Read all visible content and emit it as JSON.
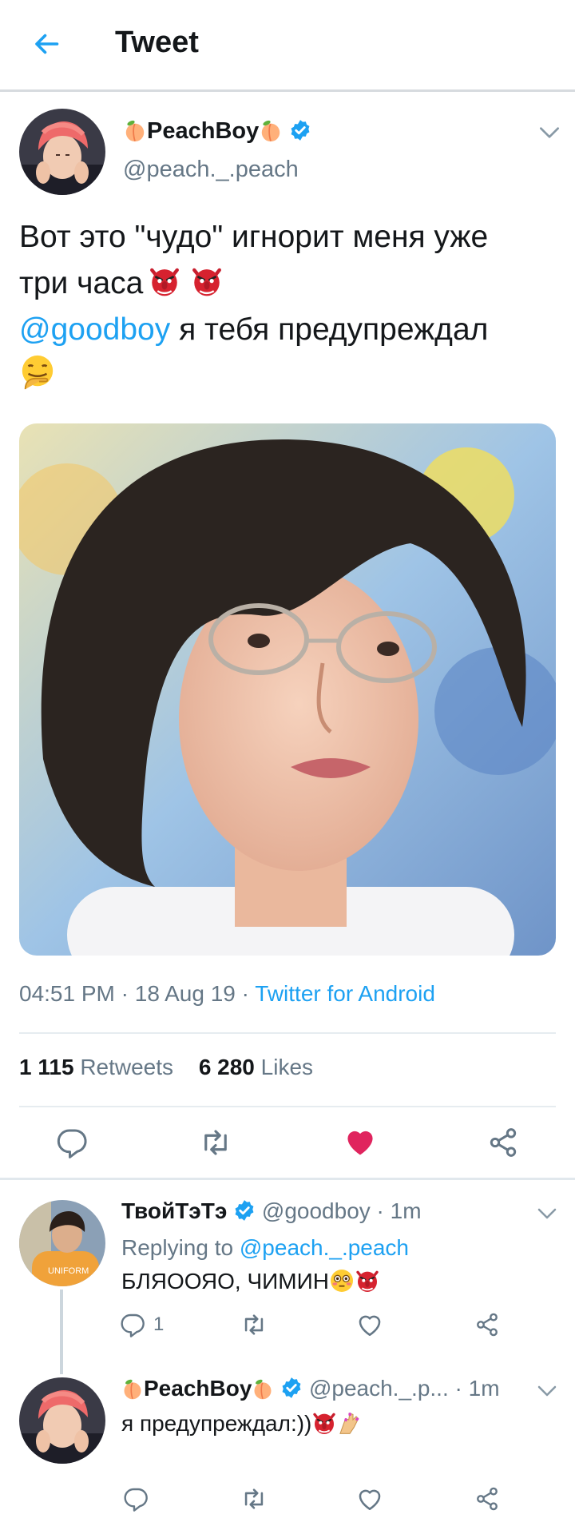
{
  "header": {
    "title": "Tweet"
  },
  "tweet": {
    "display_name": "PeachBoy",
    "handle": "@peach._.peach",
    "text_line1": "Вот это \"чудо\" игнорит меня уже",
    "text_line2": "три часа",
    "mention": "@goodboy",
    "text_line3": " я тебя предупреждал",
    "time": "04:51 PM",
    "date": "18 Aug 19",
    "source": "Twitter for Android",
    "retweets_count": "1 115",
    "retweets_label": "Retweets",
    "likes_count": "6 280",
    "likes_label": "Likes",
    "liked": true
  },
  "replies": [
    {
      "display_name": "ТвойТэТэ",
      "handle": "@goodboy",
      "time": "1m",
      "replying_label": "Replying to",
      "replying_to": "@peach._.peach",
      "text": "БЛЯООЯО, ЧИМИН",
      "reply_count": "1"
    },
    {
      "display_name": "PeachBoy",
      "handle": "@peach._.p...",
      "time": "1m",
      "text": "я предупреждал:))"
    }
  ],
  "icons": [
    "back-arrow-icon",
    "verified-badge-icon",
    "chevron-down-icon",
    "reply-icon",
    "retweet-icon",
    "heart-icon",
    "share-icon",
    "peach-emoji",
    "goblin-emoji",
    "hand-over-mouth-emoji",
    "flushed-emoji",
    "nail-polish-emoji"
  ],
  "colors": {
    "accent": "#1da1f2",
    "like": "#e0245e",
    "muted": "#657786",
    "divider": "#e6ecf0"
  }
}
